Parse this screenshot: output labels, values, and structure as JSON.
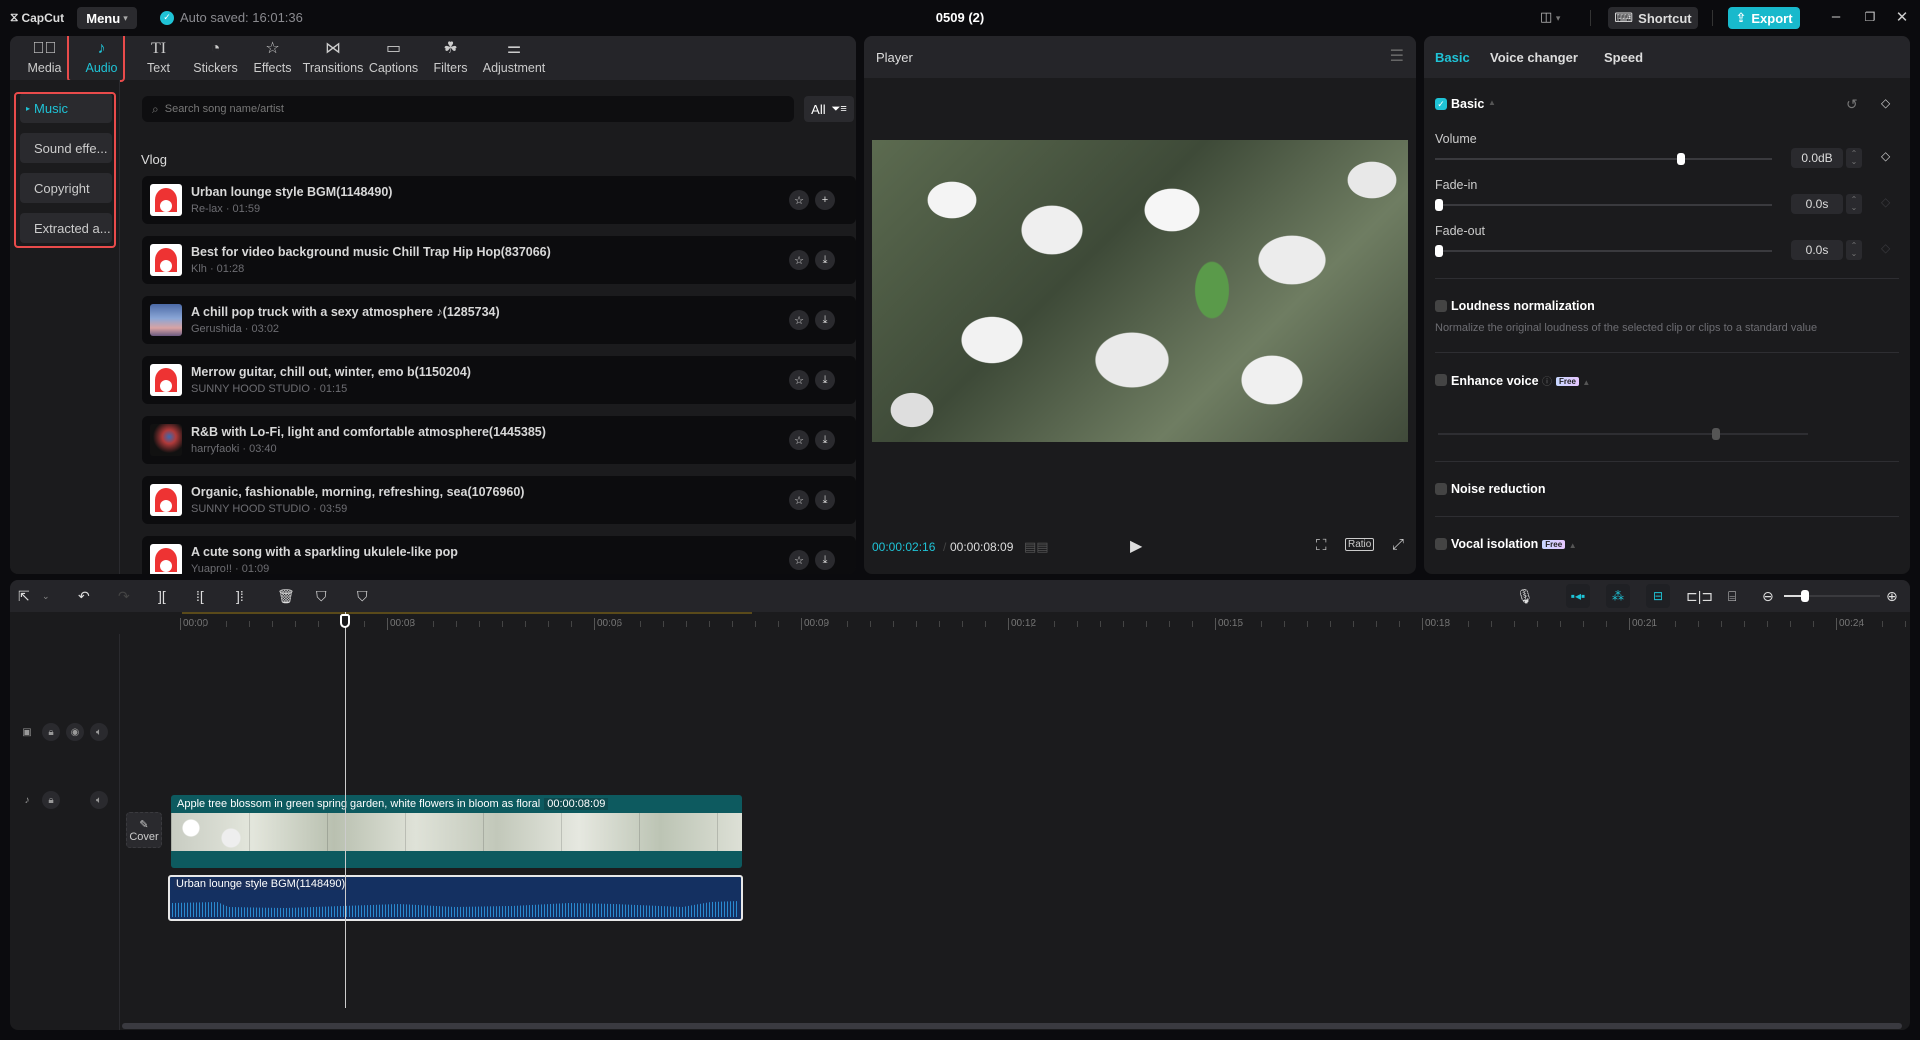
{
  "titlebar": {
    "app_name": "CapCut",
    "menu_label": "Menu",
    "autosave_text": "Auto saved: 16:01:36",
    "project_title": "0509 (2)",
    "shortcut_label": "Shortcut",
    "export_label": "Export",
    "icons": {
      "layout": "layout-icon",
      "minimize": "minimize-icon",
      "restore": "restore-icon",
      "close": "close-icon"
    }
  },
  "toolbar_tabs": [
    {
      "label": "Media",
      "icon": "media-icon"
    },
    {
      "label": "Audio",
      "icon": "audio-icon",
      "active": true
    },
    {
      "label": "Text",
      "icon": "text-icon"
    },
    {
      "label": "Stickers",
      "icon": "sticker-icon"
    },
    {
      "label": "Effects",
      "icon": "effects-icon"
    },
    {
      "label": "Transitions",
      "icon": "transitions-icon"
    },
    {
      "label": "Captions",
      "icon": "captions-icon"
    },
    {
      "label": "Filters",
      "icon": "filters-icon"
    },
    {
      "label": "Adjustment",
      "icon": "adjustment-icon"
    }
  ],
  "audio_categories": [
    {
      "label": "Music",
      "active": true
    },
    {
      "label": "Sound effe..."
    },
    {
      "label": "Copyright"
    },
    {
      "label": "Extracted a..."
    }
  ],
  "search": {
    "placeholder": "Search song name/artist",
    "filter_label": "All"
  },
  "section_title": "Vlog",
  "songs": [
    {
      "title": "Urban lounge style BGM(1148490)",
      "meta": "Re-lax · 01:59",
      "action": "add"
    },
    {
      "title": "Best for video background music Chill Trap Hip Hop(837066)",
      "meta": "Klh · 01:28",
      "action": "download"
    },
    {
      "title": "A chill pop truck with a sexy atmosphere ♪(1285734)",
      "meta": "Gerushida · 03:02",
      "action": "download"
    },
    {
      "title": "Merrow guitar, chill out, winter, emo b(1150204)",
      "meta": "SUNNY HOOD STUDIO · 01:15",
      "action": "download"
    },
    {
      "title": "R&B with Lo-Fi, light and comfortable atmosphere(1445385)",
      "meta": "harryfaoki · 03:40",
      "action": "download"
    },
    {
      "title": "Organic, fashionable, morning, refreshing, sea(1076960)",
      "meta": "SUNNY HOOD STUDIO · 03:59",
      "action": "download"
    },
    {
      "title": "A cute song with a sparkling ukulele-like pop",
      "meta": "Yuapro!! · 01:09",
      "action": "download"
    }
  ],
  "player": {
    "title": "Player",
    "current_time": "00:00:02:16",
    "total_time": "00:00:08:09",
    "ratio_label": "Ratio"
  },
  "inspector": {
    "tabs": [
      "Basic",
      "Voice changer",
      "Speed"
    ],
    "active_tab": "Basic",
    "basic_header": "Basic",
    "volume": {
      "label": "Volume",
      "value": "0.0dB",
      "slider_fraction": 0.73
    },
    "fade_in": {
      "label": "Fade-in",
      "value": "0.0s",
      "slider_fraction": 0
    },
    "fade_out": {
      "label": "Fade-out",
      "value": "0.0s",
      "slider_fraction": 0
    },
    "loudness": {
      "label": "Loudness normalization",
      "desc": "Normalize the original loudness of the selected clip or clips to a standard value",
      "checked": false
    },
    "enhance_voice": {
      "label": "Enhance voice",
      "badge": "Free",
      "checked": false,
      "slider_fraction": 0.75
    },
    "noise_reduction": {
      "label": "Noise reduction",
      "checked": false
    },
    "vocal_isolation": {
      "label": "Vocal isolation",
      "badge": "Free",
      "checked": false
    }
  },
  "timeline": {
    "ruler_labels": [
      "00:00",
      "00:03",
      "00:06",
      "00:09",
      "00:12",
      "00:15",
      "00:18",
      "00:21",
      "00:24"
    ],
    "video_clip": {
      "title": "Apple tree blossom in green spring garden, white flowers in bloom as floral",
      "duration": "00:00:08:09"
    },
    "audio_clip": {
      "title": "Urban lounge style BGM(1148490)"
    },
    "cover_label": "Cover",
    "zoom_fraction": 0.2
  },
  "colors": {
    "accent": "#1fc3d6",
    "highlight": "#e94b4b",
    "video_clip": "#0d5a5f",
    "audio_clip": "#143061"
  }
}
